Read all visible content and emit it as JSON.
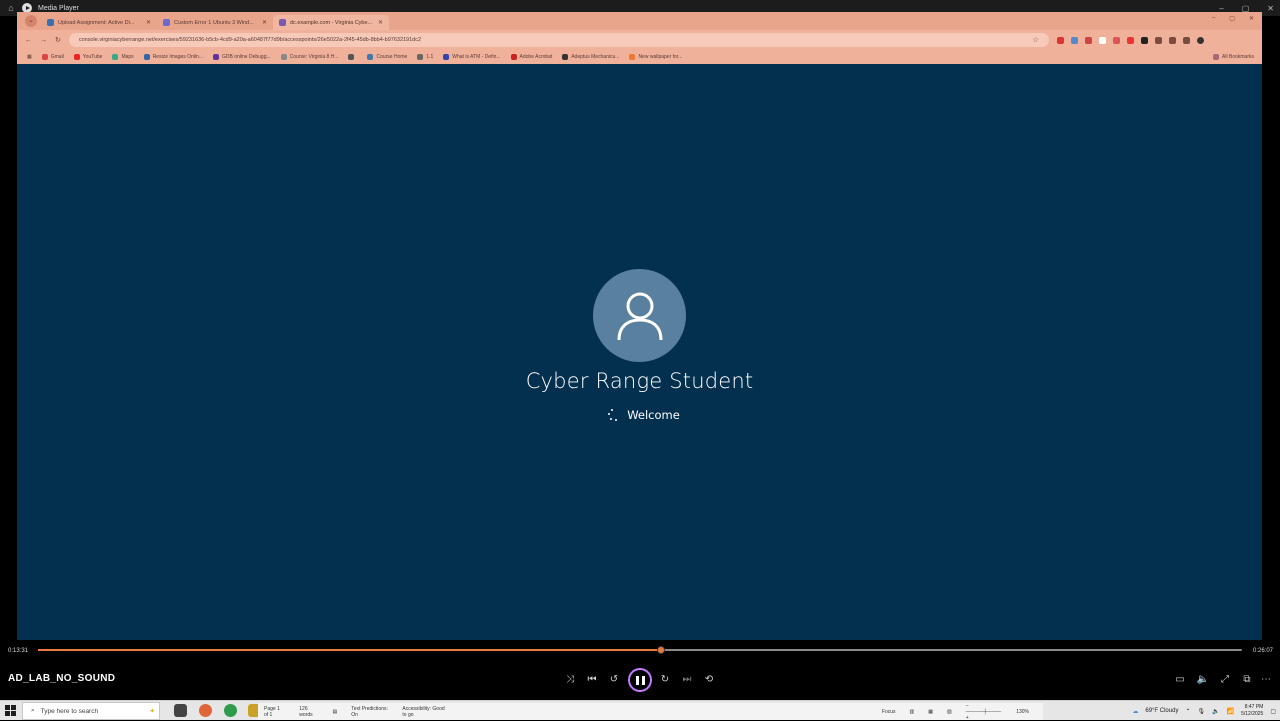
{
  "app": {
    "title": "Media Player",
    "window_controls": [
      "–",
      "▢",
      "✕"
    ]
  },
  "browser": {
    "tabs": [
      {
        "title": "Upload Assignment: Active Di...",
        "active": false,
        "fav_color": "#3a6fb0"
      },
      {
        "title": "Custom Error 1 Ubuntu 3 Wind...",
        "active": false,
        "fav_color": "#6a6ad0"
      },
      {
        "title": "dc.example.com - Virginia Cybe...",
        "active": true,
        "fav_color": "#7a5ab0"
      }
    ],
    "url": "console.virginiacyberrange.net/exercises/59231636-b5cb-4cd9-a20a-a60487f77d9b/accesspoints/26e5022a-2f45-45db-8bb4-b97632191dc2",
    "bookmarks": [
      {
        "label": "Gmail",
        "color": "#d44"
      },
      {
        "label": "YouTube",
        "color": "#e22"
      },
      {
        "label": "Maps",
        "color": "#3a8"
      },
      {
        "label": "Resize Images Onlin...",
        "color": "#36a"
      },
      {
        "label": "GDB online Debugg...",
        "color": "#639"
      },
      {
        "label": "Course: Virginia 8 H...",
        "color": "#888"
      },
      {
        "label": "",
        "color": "#555"
      },
      {
        "label": "Course Home",
        "color": "#47a"
      },
      {
        "label": "1.1",
        "color": "#666"
      },
      {
        "label": "What is ATM - Defin...",
        "color": "#34a"
      },
      {
        "label": "Adobe Acrobat",
        "color": "#c22"
      },
      {
        "label": "Adeptus Mechanicu...",
        "color": "#333"
      },
      {
        "label": "New wallpaper for...",
        "color": "#e73"
      }
    ],
    "all_bookmarks": "All Bookmarks"
  },
  "welcome_screen": {
    "username": "Cyber Range Student",
    "status": "Welcome",
    "background": "#04304f"
  },
  "player": {
    "current_time": "0:13:31",
    "total_time": "0:26:07",
    "progress": 0.5175,
    "media_title": "AD_LAB_NO_SOUND",
    "accent": "#e7793c"
  },
  "taskbar": {
    "search_placeholder": "Type here to search",
    "word_status": {
      "page": "Page 1 of 1",
      "words": "126 words",
      "predictions": "Text Predictions: On",
      "accessibility": "Accessibility: Good to go",
      "focus": "Focus",
      "zoom": "130%"
    },
    "weather": "69°F  Cloudy",
    "time": "8:47 PM",
    "date": "5/12/2025"
  }
}
